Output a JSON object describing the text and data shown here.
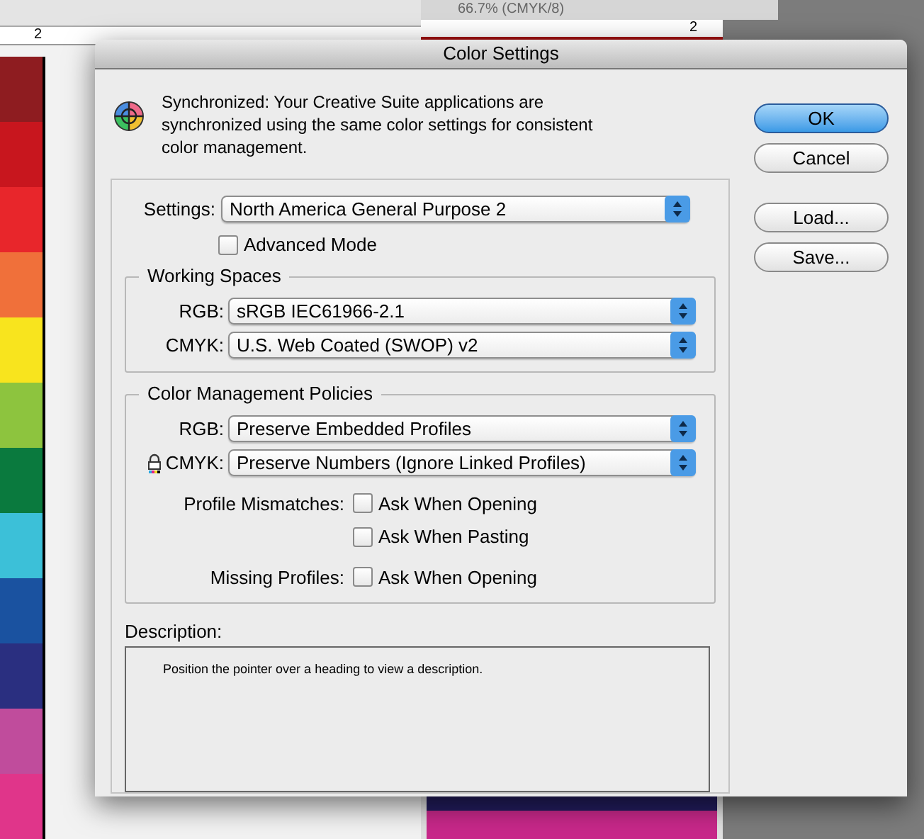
{
  "background": {
    "document_tab": "66.7% (CMYK/8)",
    "left_ruler_label": "2",
    "right_ruler_label": "2",
    "swatches": [
      {
        "color": "#8e1c20"
      },
      {
        "color": "#c8161e"
      },
      {
        "color": "#e8262b"
      },
      {
        "color": "#f0703a"
      },
      {
        "color": "#f8e41e"
      },
      {
        "color": "#8dc43e"
      },
      {
        "color": "#0a7a3e"
      },
      {
        "color": "#3cc0d8"
      },
      {
        "color": "#1a52a0"
      },
      {
        "color": "#2a2f80"
      },
      {
        "color": "#c04c9c"
      },
      {
        "color": "#e0358a"
      }
    ]
  },
  "dialog": {
    "title": "Color Settings",
    "message": "Synchronized: Your Creative Suite applications are synchronized using the same color settings for consistent color management.",
    "settings": {
      "label": "Settings:",
      "value": "North America General Purpose 2"
    },
    "advanced_mode": {
      "label": "Advanced Mode",
      "checked": false
    },
    "working_spaces": {
      "title": "Working Spaces",
      "rows": [
        {
          "label": "RGB:",
          "value": "sRGB IEC61966-2.1",
          "locked": false
        },
        {
          "label": "CMYK:",
          "value": "U.S. Web Coated (SWOP) v2",
          "locked": false
        }
      ]
    },
    "policies": {
      "title": "Color Management Policies",
      "rows": [
        {
          "label": "RGB:",
          "value": "Preserve Embedded Profiles",
          "locked": false
        },
        {
          "label": "CMYK:",
          "value": "Preserve Numbers (Ignore Linked Profiles)",
          "locked": true
        }
      ],
      "checks": [
        {
          "label": "Profile Mismatches:",
          "options": [
            {
              "label": "Ask When Opening",
              "checked": false
            },
            {
              "label": "Ask When Pasting",
              "checked": false
            }
          ]
        },
        {
          "label": "Missing Profiles:",
          "options": [
            {
              "label": "Ask When Opening",
              "checked": false
            }
          ]
        }
      ]
    },
    "description": {
      "label": "Description:",
      "text": "Position the pointer over a heading to view a description."
    },
    "buttons": [
      {
        "label": "OK",
        "default": true
      },
      {
        "label": "Cancel",
        "default": false
      },
      {
        "label": "Load...",
        "default": false
      },
      {
        "label": "Save...",
        "default": false
      }
    ]
  }
}
